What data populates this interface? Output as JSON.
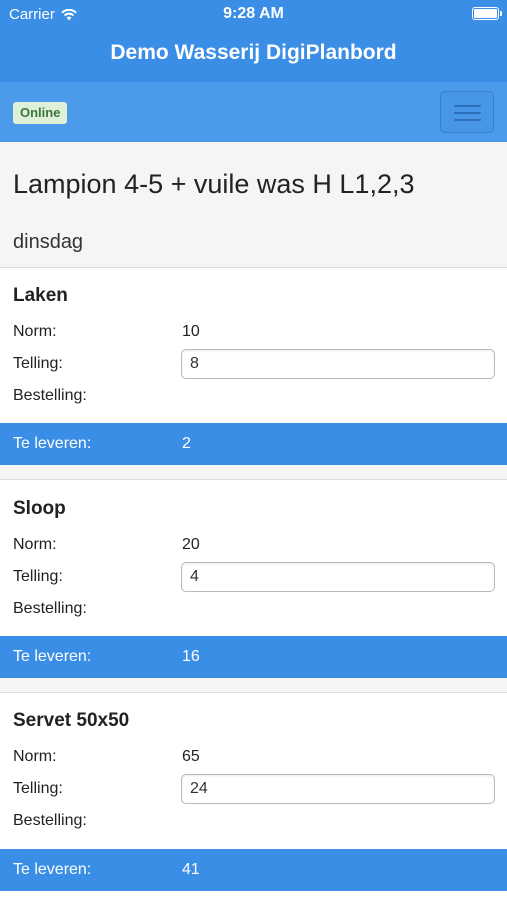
{
  "statusbar": {
    "carrier": "Carrier",
    "time": "9:28 AM",
    "wifi_icon": "wifi-icon",
    "battery_icon": "battery-icon"
  },
  "app": {
    "title": "Demo Wasserij DigiPlanbord"
  },
  "navbar": {
    "status_badge": "Online",
    "menu_icon": "hamburger-menu-icon"
  },
  "header": {
    "title": "Lampion 4-5 + vuile was H L1,2,3",
    "day": "dinsdag"
  },
  "labels": {
    "norm": "Norm:",
    "count": "Telling:",
    "order": "Bestelling:",
    "deliver": "Te leveren:"
  },
  "items": [
    {
      "name": "Laken",
      "norm": "10",
      "count": "8",
      "order": "",
      "deliver": "2"
    },
    {
      "name": "Sloop",
      "norm": "20",
      "count": "4",
      "order": "",
      "deliver": "16"
    },
    {
      "name": "Servet 50x50",
      "norm": "65",
      "count": "24",
      "order": "",
      "deliver": "41"
    }
  ],
  "colors": {
    "primary": "#3a8ee6",
    "navbar": "#4c9aea",
    "badge_bg": "#dff0d8",
    "badge_text": "#3c763d",
    "header_bg": "#f5f5f5"
  }
}
